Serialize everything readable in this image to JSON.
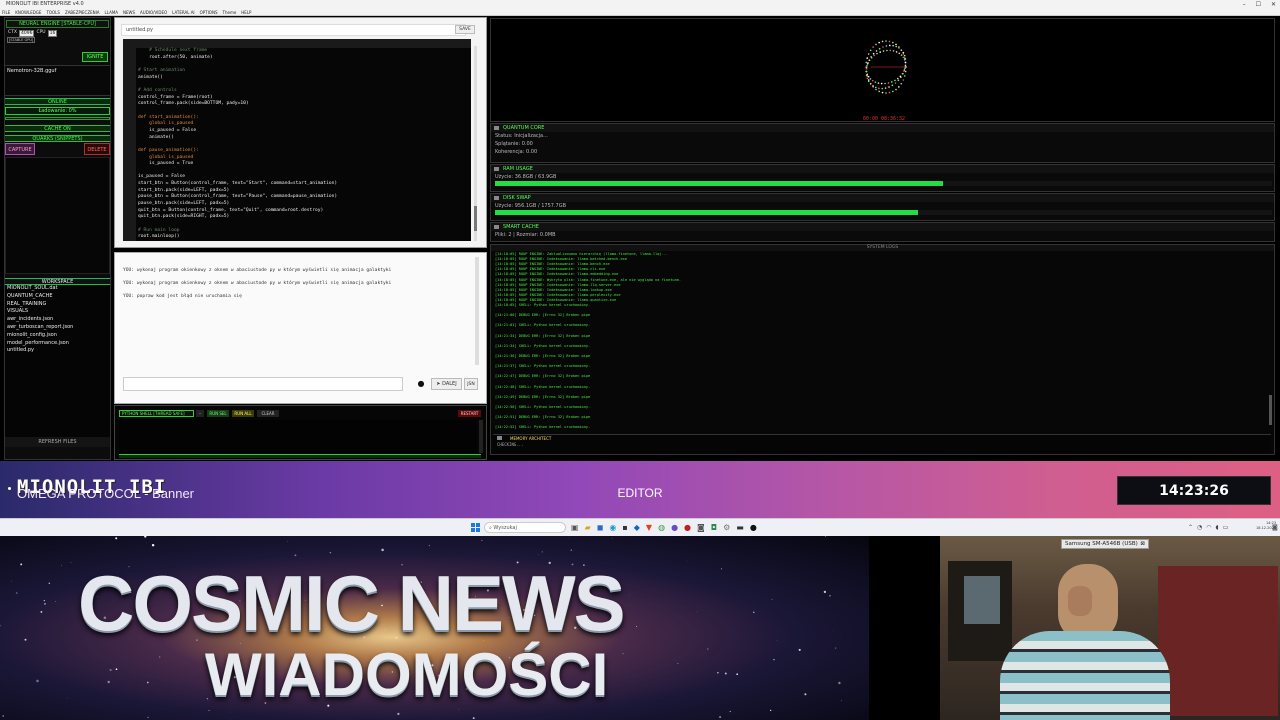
{
  "window": {
    "title": "MIONOLIT IBI ENTERPRISE v4.0",
    "menu": [
      "FILE",
      "KNOWLEDGE",
      "TOOLS",
      "ZABEZPIECZENIA",
      "LLAMA",
      "NEWS",
      "AUDIO/VIDEO",
      "LATERAL AI",
      "OPTIONS",
      "Theme",
      "HELP"
    ]
  },
  "left_panel": {
    "engine_title": "NEURAL ENGINE [STABLE-CPU]",
    "ctx_label": "CTX",
    "ctx_value": "4096",
    "cpu_label": "CPU",
    "cpu_value": "16",
    "mode_badge": "[STABLE GPU]",
    "ignite_label": "IGNITE",
    "model_name": "Nemotron-32B.gguf",
    "status_online": "ONLINE",
    "loading": "Ładowanie: 0%",
    "cache_status": "CACHE ON",
    "quarks_title": "QUARKS (SNIPPETS)",
    "capture_label": "CAPTURE",
    "delete_label": "DELETE",
    "workspace_title": "WORKSPACE",
    "workspace_files": [
      "MIONOLIT_SOUL.dat",
      "QUANTUM_CACHE",
      "REAL_TRAINING",
      "VISUALS",
      "awr_incidents.json",
      "awr_turboscan_report.json",
      "mionolit_config.json",
      "model_performance.json",
      "untitled.py"
    ],
    "refresh_label": "REFRESH FILES"
  },
  "editor": {
    "filename": "untitled.py",
    "save_label": "SAVE",
    "code_lines": [
      {
        "t": "    # Schedule next frame",
        "c": "cm"
      },
      {
        "t": "    root.after(50, animate)",
        "c": ""
      },
      {
        "t": "",
        "c": ""
      },
      {
        "t": "# Start animation",
        "c": "cm"
      },
      {
        "t": "animate()",
        "c": ""
      },
      {
        "t": "",
        "c": ""
      },
      {
        "t": "# Add controls",
        "c": "cm"
      },
      {
        "t": "control_frame = Frame(root)",
        "c": ""
      },
      {
        "t": "control_frame.pack(side=BOTTOM, pady=10)",
        "c": ""
      },
      {
        "t": "",
        "c": ""
      },
      {
        "t": "def start_animation():",
        "c": "kw"
      },
      {
        "t": "    global is_paused",
        "c": "kw"
      },
      {
        "t": "    is_paused = False",
        "c": ""
      },
      {
        "t": "    animate()",
        "c": ""
      },
      {
        "t": "",
        "c": ""
      },
      {
        "t": "def pause_animation():",
        "c": "kw"
      },
      {
        "t": "    global is_paused",
        "c": "kw"
      },
      {
        "t": "    is_paused = True",
        "c": ""
      },
      {
        "t": "",
        "c": ""
      },
      {
        "t": "is_paused = False",
        "c": ""
      },
      {
        "t": "start_btn = Button(control_frame, text=\"Start\", command=start_animation)",
        "c": ""
      },
      {
        "t": "start_btn.pack(side=LEFT, padx=5)",
        "c": ""
      },
      {
        "t": "pause_btn = Button(control_frame, text=\"Pause\", command=pause_animation)",
        "c": ""
      },
      {
        "t": "pause_btn.pack(side=LEFT, padx=5)",
        "c": ""
      },
      {
        "t": "quit_btn = Button(control_frame, text=\"Quit\", command=root.destroy)",
        "c": ""
      },
      {
        "t": "quit_btn.pack(side=RIGHT, padx=5)",
        "c": ""
      },
      {
        "t": "",
        "c": ""
      },
      {
        "t": "# Run main loop",
        "c": "cm"
      },
      {
        "t": "root.mainloop()",
        "c": ""
      }
    ]
  },
  "chat": {
    "messages": [
      "YOU: wykonaj program okienkowy z oknem w abaciustode py w którym wyświetli się animacja galaktyki",
      "YOU: wykonaj program okienkowy z oknem w abaciustode py w którym wyświetli się animacja galaktyki",
      "YOU: popraw kod jest błąd nie uruchamia się"
    ],
    "send_label": "DALEJ",
    "extra_label": "JSN"
  },
  "shell": {
    "title": "PYTHON SHELL [THREAD SAFE]",
    "run_sel": "RUN SEL",
    "run_all": "RUN ALL",
    "clear": "CLEAR",
    "restart": "RESTART",
    "hide": "HIDE"
  },
  "viz": {
    "timer": "00:00 08:36:32"
  },
  "quantum": {
    "title": "QUANTUM CORE",
    "status": "Status: Inicjalizacja...",
    "entanglement": "Splątanie: 0.00",
    "coherence": "Koherencja: 0.00"
  },
  "ram": {
    "title": "RAM USAGE",
    "text": "Użycie: 36.8GB / 63.9GB",
    "fraction": 0.576
  },
  "disk": {
    "title": "DISK SWAP",
    "text": "Użycie: 956.1GB / 1757.7GB",
    "fraction": 0.544
  },
  "cache": {
    "title": "SMART CACHE",
    "text": "Pliki: 2 | Rozmiar: 0.0MB"
  },
  "logs": {
    "title": "SYSTEM LOGS",
    "lines": [
      "[14:18:05] ROUP ENGINE: Zaktualizowano hierarchię (llama-finetune, llama-llq)...",
      "[14:18:05] ROUP ENGINE: Indeksowanie: llama-batched-bench.exe",
      "[14:18:05] ROUP ENGINE: Indeksowanie: llama-bench.exe",
      "[14:18:05] ROUP ENGINE: Indeksowanie: llama-cli.exe",
      "[14:18:05] ROUP ENGINE: Indeksowanie: llama-embedding.exe",
      "[14:18:05] ROUP ENGINE: Wykryto plik: llama-finetune.exe, ale nie wygląda na finetune.",
      "[14:18:05] ROUP ENGINE: Indeksowanie: llama-llq-server.exe",
      "[14:18:05] ROUP ENGINE: Indeksowanie: llama-lookup.exe",
      "[14:18:05] ROUP ENGINE: Indeksowanie: llama-perplexity.exe",
      "[14:18:05] ROUP ENGINE: Indeksowanie: llama-quantize.exe",
      "[14:18:05] SHELL: Python kernel uruchomiony.",
      "",
      "[14:21:00] DEBUG ERR: [Errno 32] Broken pipe",
      "",
      "[14:21:01] SHELL: Python kernel uruchomiony.",
      "",
      "[14:21:34] DEBUG ERR: [Errno 32] Broken pipe",
      "",
      "[14:21:34] SHELL: Python kernel uruchomiony.",
      "",
      "[14:21:36] DEBUG ERR: [Errno 32] Broken pipe",
      "",
      "[14:21:37] SHELL: Python kernel uruchomiony.",
      "",
      "[14:22:47] DEBUG ERR: [Errno 32] Broken pipe",
      "",
      "[14:22:48] SHELL: Python kernel uruchomiony.",
      "",
      "[14:22:49] DEBUG ERR: [Errno 32] Broken pipe",
      "",
      "[14:22:50] SHELL: Python kernel uruchomiony.",
      "",
      "[14:22:51] DEBUG ERR: [Errno 32] Broken pipe",
      "",
      "[14:22:52] SHELL: Python kernel uruchomiony."
    ],
    "memory_title": "MEMORY ARCHITECT",
    "memory_status": "CHECKING..."
  },
  "banner": {
    "title": "MIONOLIT IBI",
    "subtitle": "OMEGA PROTOCOL - Banner",
    "mode": "EDITOR",
    "clock": "14:23:26"
  },
  "taskbar": {
    "search_placeholder": "Wyszukaj",
    "time": "14:23",
    "date": "18.12.2025"
  },
  "news": {
    "line1": "COSMIC NEWS",
    "line2": "WIADOMOŚCI"
  },
  "camera": {
    "label": "Samsung SM-A546B (USB)"
  },
  "colors": {
    "accent_green": "#22dd44",
    "error_red": "#c0392b"
  }
}
